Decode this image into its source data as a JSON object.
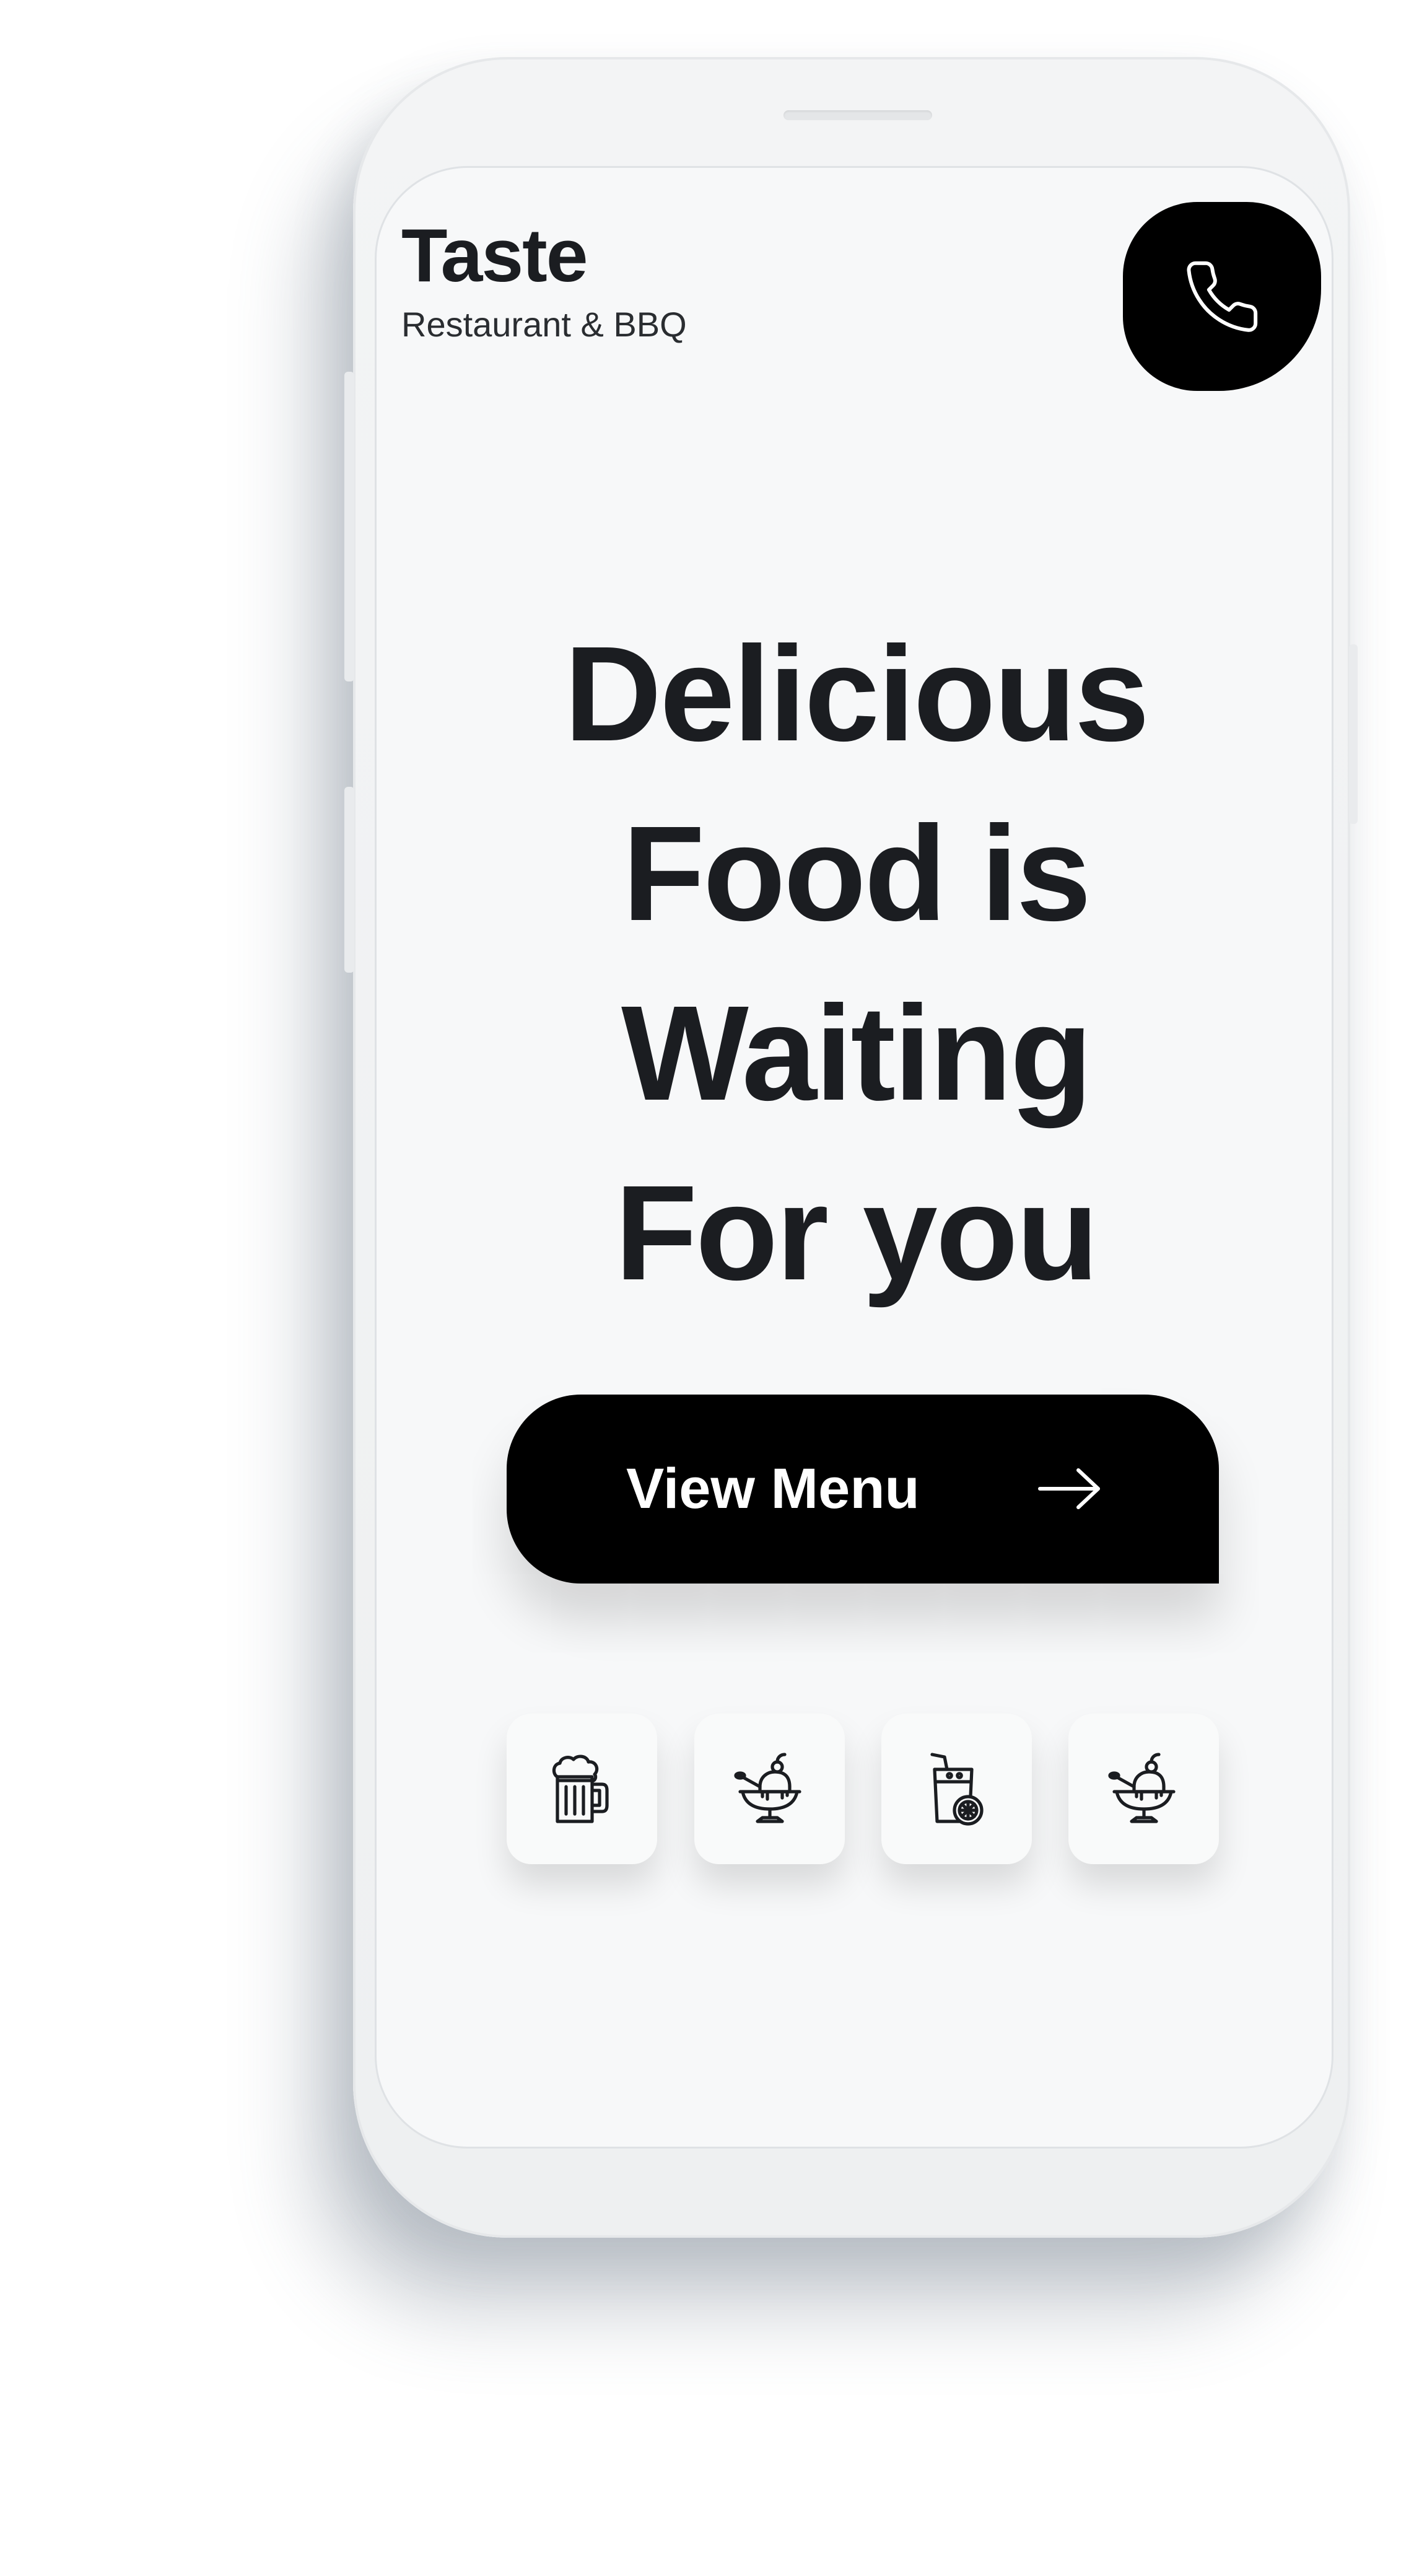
{
  "header": {
    "brand_name": "Taste",
    "brand_tagline": "Restaurant & BBQ",
    "call_icon": "phone-icon"
  },
  "hero": {
    "headline_lines": [
      "Delicious",
      "Food is",
      "Waiting",
      "For you"
    ]
  },
  "cta": {
    "label": "View Menu",
    "icon": "arrow-right-icon"
  },
  "categories": [
    {
      "icon": "beer-mug-icon"
    },
    {
      "icon": "sundae-icon"
    },
    {
      "icon": "lemonade-glass-icon"
    },
    {
      "icon": "sundae-icon"
    }
  ],
  "colors": {
    "screen_background": "#f7f8f9",
    "text_primary": "#1b1d21",
    "button_background": "#000000",
    "button_text": "#ffffff"
  }
}
